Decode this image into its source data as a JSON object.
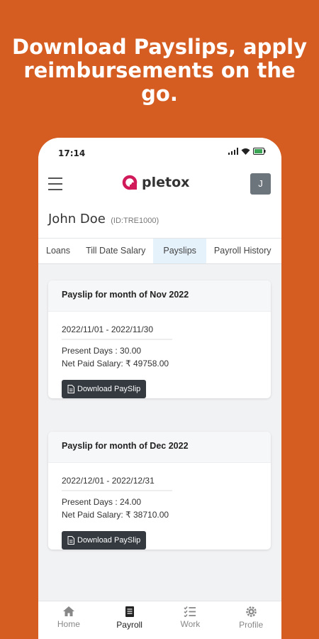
{
  "headline": [
    "Download Payslips, apply",
    "reimbursements on the",
    "go."
  ],
  "status": {
    "time": "17:14"
  },
  "app": {
    "brand": "pletox",
    "avatar_initial": "J"
  },
  "user": {
    "name": "John Doe",
    "id": "(ID:TRE1000)"
  },
  "tabs": [
    "Loans",
    "Till Date Salary",
    "Payslips",
    "Payroll History"
  ],
  "active_tab": "Payslips",
  "payslips": [
    {
      "title": "Payslip for month of Nov 2022",
      "period": "2022/11/01 - 2022/11/30",
      "present_days": "Present Days : 30.00",
      "net_paid": "Net Paid Salary: ₹ 49758.00",
      "button": "Download PaySlip"
    },
    {
      "title": "Payslip for month of Dec 2022",
      "period": "2022/12/01 - 2022/12/31",
      "present_days": "Present Days : 24.00",
      "net_paid": "Net Paid Salary: ₹ 38710.00",
      "button": "Download PaySlip"
    }
  ],
  "bottom_nav": [
    {
      "label": "Home",
      "icon": "home-icon"
    },
    {
      "label": "Payroll",
      "icon": "document-icon"
    },
    {
      "label": "Work",
      "icon": "checklist-icon"
    },
    {
      "label": "Profile",
      "icon": "gear-icon"
    }
  ],
  "colors": {
    "background": "#d65d21",
    "brand_accent": "#d11a5a",
    "button": "#343a40",
    "active_tab": "#e5f1fb"
  }
}
